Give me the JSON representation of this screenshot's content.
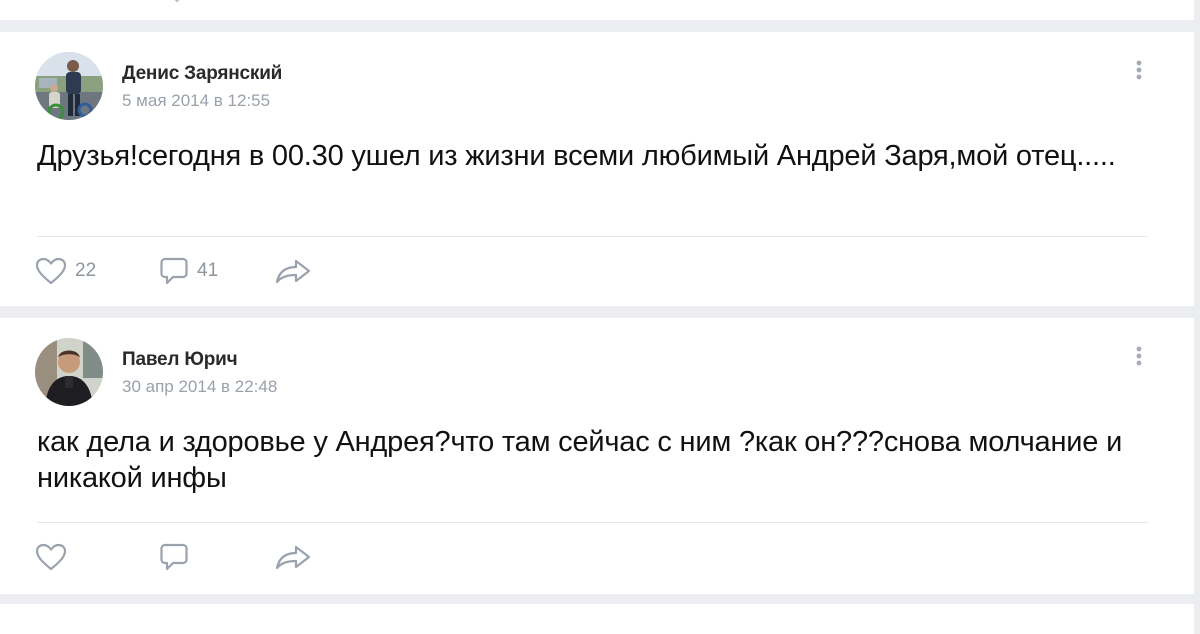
{
  "posts": [
    {
      "author": "Денис Зарянский",
      "date": "5 мая 2014 в 12:55",
      "text": "Друзья!сегодня в 00.30 ушел из жизни всеми любимый Андрей Заря,мой отец.....",
      "likes": "22",
      "comments": "41",
      "avatar": "avatar"
    },
    {
      "author": "Павел Юрич",
      "date": "30 апр 2014 в 22:48",
      "text": "как дела и здоровье у Андрея?что там сейчас с ним ?как он???снова молчание и никакой инфы",
      "likes": "",
      "comments": "",
      "avatar": "avatar"
    }
  ],
  "icons": {
    "like": "heart-icon",
    "comment": "comment-icon",
    "share": "share-icon",
    "more": "more-vertical-icon"
  },
  "colors": {
    "background": "#ebedf0",
    "card": "#ffffff",
    "text": "#111111",
    "author": "#2a2a2a",
    "meta": "#9aa1ab",
    "icon": "#99a2ad"
  }
}
